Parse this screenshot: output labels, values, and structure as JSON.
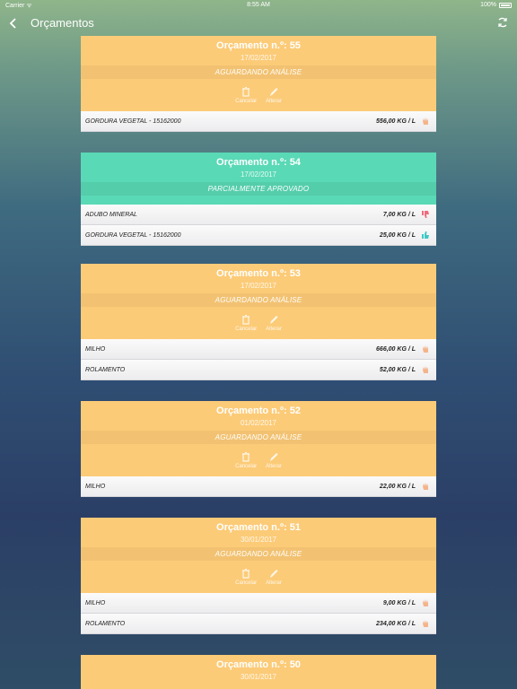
{
  "status_bar": {
    "carrier": "Carrier ᯤ",
    "time": "8:55 AM",
    "battery": "100%"
  },
  "nav": {
    "title": "Orçamentos"
  },
  "colors": {
    "pending": "#fccb78",
    "approved": "#5ad9b6",
    "thumb_down": "#f06b7a",
    "thumb_up": "#3bc8c6",
    "hand": "#f4b48a"
  },
  "actions": {
    "cancel": "Cancelar",
    "edit": "Alterar"
  },
  "cards": [
    {
      "title": "Orçamento n.º: 55",
      "date": "17/02/2017",
      "status": "AGUARDANDO ANÁLISE",
      "items": [
        {
          "name": "GORDURA VEGETAL - 15162000",
          "qty": "556,00 KG / L",
          "icon": "hand-icon"
        }
      ]
    },
    {
      "title": "Orçamento n.º: 54",
      "date": "17/02/2017",
      "status": "PARCIALMENTE APROVADO",
      "items": [
        {
          "name": "ADUBO MINERAL",
          "qty": "7,00 KG / L",
          "icon": "thumbs-down-icon"
        },
        {
          "name": "GORDURA VEGETAL - 15162000",
          "qty": "25,00 KG / L",
          "icon": "thumbs-up-icon"
        }
      ]
    },
    {
      "title": "Orçamento n.º: 53",
      "date": "17/02/2017",
      "status": "AGUARDANDO ANÁLISE",
      "items": [
        {
          "name": "MILHO",
          "qty": "666,00 KG / L",
          "icon": "hand-icon"
        },
        {
          "name": "ROLAMENTO",
          "qty": "52,00 KG / L",
          "icon": "hand-icon"
        }
      ]
    },
    {
      "title": "Orçamento n.º: 52",
      "date": "01/02/2017",
      "status": "AGUARDANDO ANÁLISE",
      "items": [
        {
          "name": "MILHO",
          "qty": "22,00 KG / L",
          "icon": "hand-icon"
        }
      ]
    },
    {
      "title": "Orçamento n.º: 51",
      "date": "30/01/2017",
      "status": "AGUARDANDO ANÁLISE",
      "items": [
        {
          "name": "MILHO",
          "qty": "9,00 KG / L",
          "icon": "hand-icon"
        },
        {
          "name": "ROLAMENTO",
          "qty": "234,00 KG / L",
          "icon": "hand-icon"
        }
      ]
    },
    {
      "title": "Orçamento n.º: 50",
      "date": "30/01/2017"
    }
  ]
}
